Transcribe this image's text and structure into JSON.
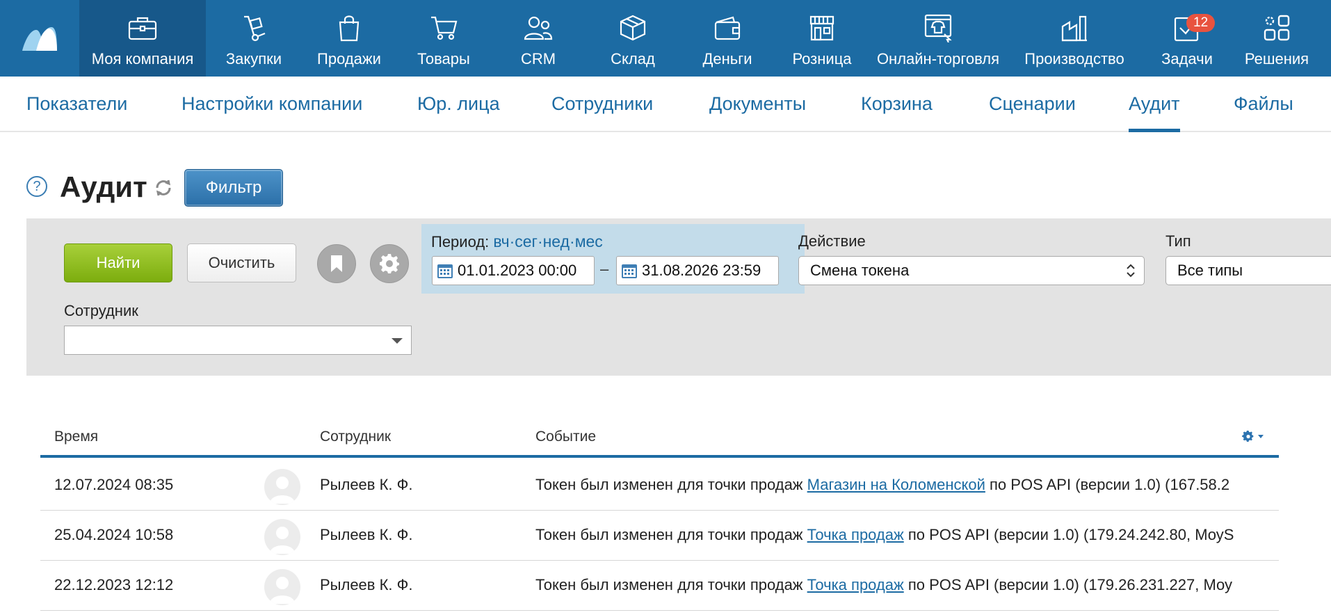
{
  "topnav": {
    "items": [
      {
        "label": "Моя компания",
        "icon": "briefcase-icon",
        "active": true
      },
      {
        "label": "Закупки",
        "icon": "hand-truck-icon"
      },
      {
        "label": "Продажи",
        "icon": "shopping-bag-icon"
      },
      {
        "label": "Товары",
        "icon": "cart-icon"
      },
      {
        "label": "CRM",
        "icon": "people-icon"
      },
      {
        "label": "Склад",
        "icon": "box-icon"
      },
      {
        "label": "Деньги",
        "icon": "wallet-icon"
      },
      {
        "label": "Розница",
        "icon": "store-icon"
      },
      {
        "label": "Онлайн-торговля",
        "icon": "online-shop-icon"
      },
      {
        "label": "Производство",
        "icon": "factory-icon"
      },
      {
        "label": "Задачи",
        "icon": "tasks-icon",
        "badge": "12"
      },
      {
        "label": "Решения",
        "icon": "apps-icon"
      }
    ]
  },
  "subnav": {
    "tabs": [
      {
        "label": "Показатели"
      },
      {
        "label": "Настройки компании"
      },
      {
        "label": "Юр. лица"
      },
      {
        "label": "Сотрудники"
      },
      {
        "label": "Документы"
      },
      {
        "label": "Корзина"
      },
      {
        "label": "Сценарии"
      },
      {
        "label": "Аудит",
        "active": true
      },
      {
        "label": "Файлы"
      }
    ]
  },
  "page": {
    "help": "?",
    "title": "Аудит",
    "filter_button": "Фильтр"
  },
  "filter": {
    "find_label": "Найти",
    "clear_label": "Очистить",
    "period_label": "Период:",
    "period_links": [
      "вч",
      "сег",
      "нед",
      "мес"
    ],
    "date_from": "01.01.2023 00:00",
    "date_to": "31.08.2026 23:59",
    "dash": "–",
    "action_label": "Действие",
    "action_value": "Смена токена",
    "type_label": "Тип",
    "type_value": "Все типы",
    "employee_label": "Сотрудник",
    "employee_value": ""
  },
  "table": {
    "columns": {
      "time": "Время",
      "employee": "Сотрудник",
      "event": "Событие"
    },
    "rows": [
      {
        "time": "12.07.2024 08:35",
        "employee": "Рылеев К. Ф.",
        "event_pre": "Токен был изменен для точки продаж ",
        "event_link": "Магазин на Коломенской",
        "event_post": " по POS API (версии 1.0) (167.58.2"
      },
      {
        "time": "25.04.2024 10:58",
        "employee": "Рылеев К. Ф.",
        "event_pre": "Токен был изменен для точки продаж ",
        "event_link": "Точка продаж",
        "event_post": " по POS API (версии 1.0) (179.24.242.80, МоуS"
      },
      {
        "time": "22.12.2023 12:12",
        "employee": "Рылеев К. Ф.",
        "event_pre": "Токен был изменен для точки продаж ",
        "event_link": "Точка продаж",
        "event_post": " по POS API (версии 1.0) (179.26.231.227, Моу"
      }
    ]
  },
  "colors": {
    "brand": "#1c6ba3",
    "active_nav": "#17588a",
    "find": "#8dbb1f",
    "badge": "#e8533f"
  }
}
